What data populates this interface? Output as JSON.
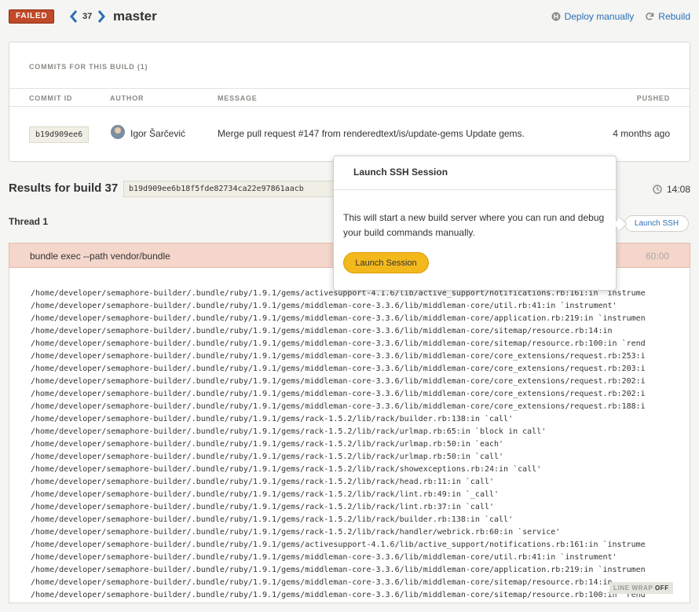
{
  "header": {
    "status": "FAILED",
    "build_number": "37",
    "branch": "master",
    "deploy_label": "Deploy manually",
    "rebuild_label": "Rebuild"
  },
  "commits": {
    "title": "COMMITS FOR THIS BUILD (1)",
    "columns": {
      "commit_id": "COMMIT ID",
      "author": "AUTHOR",
      "message": "MESSAGE",
      "pushed": "PUSHED"
    },
    "rows": [
      {
        "sha": "b19d909ee6",
        "author": "Igor Šarčević",
        "message": "Merge pull request #147 from renderedtext/is/update-gems Update gems.",
        "pushed": "4 months ago"
      }
    ]
  },
  "results": {
    "title": "Results for build 37",
    "sha": "b19d909ee6b18f5fde82734ca22e97861aacb",
    "duration": "14:08"
  },
  "thread": {
    "title": "Thread 1",
    "ssh_button": "Launch SSH"
  },
  "command": {
    "text": "bundle exec --path vendor/bundle",
    "time": "60:00"
  },
  "log_lines": [
    "/home/developer/semaphore-builder/.bundle/ruby/1.9.1/gems/activesupport-4.1.6/lib/active_support/notifications.rb:161:in `instrume",
    "/home/developer/semaphore-builder/.bundle/ruby/1.9.1/gems/middleman-core-3.3.6/lib/middleman-core/util.rb:41:in `instrument'",
    "/home/developer/semaphore-builder/.bundle/ruby/1.9.1/gems/middleman-core-3.3.6/lib/middleman-core/application.rb:219:in `instrumen",
    "/home/developer/semaphore-builder/.bundle/ruby/1.9.1/gems/middleman-core-3.3.6/lib/middleman-core/sitemap/resource.rb:14:in",
    "/home/developer/semaphore-builder/.bundle/ruby/1.9.1/gems/middleman-core-3.3.6/lib/middleman-core/sitemap/resource.rb:100:in `rend",
    "/home/developer/semaphore-builder/.bundle/ruby/1.9.1/gems/middleman-core-3.3.6/lib/middleman-core/core_extensions/request.rb:253:i",
    "/home/developer/semaphore-builder/.bundle/ruby/1.9.1/gems/middleman-core-3.3.6/lib/middleman-core/core_extensions/request.rb:203:i",
    "/home/developer/semaphore-builder/.bundle/ruby/1.9.1/gems/middleman-core-3.3.6/lib/middleman-core/core_extensions/request.rb:202:i",
    "/home/developer/semaphore-builder/.bundle/ruby/1.9.1/gems/middleman-core-3.3.6/lib/middleman-core/core_extensions/request.rb:202:i",
    "/home/developer/semaphore-builder/.bundle/ruby/1.9.1/gems/middleman-core-3.3.6/lib/middleman-core/core_extensions/request.rb:188:i",
    "/home/developer/semaphore-builder/.bundle/ruby/1.9.1/gems/rack-1.5.2/lib/rack/builder.rb:138:in `call'",
    "/home/developer/semaphore-builder/.bundle/ruby/1.9.1/gems/rack-1.5.2/lib/rack/urlmap.rb:65:in `block in call'",
    "/home/developer/semaphore-builder/.bundle/ruby/1.9.1/gems/rack-1.5.2/lib/rack/urlmap.rb:50:in `each'",
    "/home/developer/semaphore-builder/.bundle/ruby/1.9.1/gems/rack-1.5.2/lib/rack/urlmap.rb:50:in `call'",
    "/home/developer/semaphore-builder/.bundle/ruby/1.9.1/gems/rack-1.5.2/lib/rack/showexceptions.rb:24:in `call'",
    "/home/developer/semaphore-builder/.bundle/ruby/1.9.1/gems/rack-1.5.2/lib/rack/head.rb:11:in `call'",
    "/home/developer/semaphore-builder/.bundle/ruby/1.9.1/gems/rack-1.5.2/lib/rack/lint.rb:49:in `_call'",
    "/home/developer/semaphore-builder/.bundle/ruby/1.9.1/gems/rack-1.5.2/lib/rack/lint.rb:37:in `call'",
    "/home/developer/semaphore-builder/.bundle/ruby/1.9.1/gems/rack-1.5.2/lib/rack/builder.rb:138:in `call'",
    "/home/developer/semaphore-builder/.bundle/ruby/1.9.1/gems/rack-1.5.2/lib/rack/handler/webrick.rb:60:in `service'",
    "/home/developer/semaphore-builder/.bundle/ruby/1.9.1/gems/activesupport-4.1.6/lib/active_support/notifications.rb:161:in `instrume",
    "/home/developer/semaphore-builder/.bundle/ruby/1.9.1/gems/middleman-core-3.3.6/lib/middleman-core/util.rb:41:in `instrument'",
    "/home/developer/semaphore-builder/.bundle/ruby/1.9.1/gems/middleman-core-3.3.6/lib/middleman-core/application.rb:219:in `instrumen",
    "/home/developer/semaphore-builder/.bundle/ruby/1.9.1/gems/middleman-core-3.3.6/lib/middleman-core/sitemap/resource.rb:14:in",
    "/home/developer/semaphore-builder/.bundle/ruby/1.9.1/gems/middleman-core-3.3.6/lib/middleman-core/sitemap/resource.rb:100:in `rend"
  ],
  "line_wrap": {
    "label": "LINE WRAP",
    "state": "OFF"
  },
  "popover": {
    "title": "Launch SSH Session",
    "body": "This will start a new build server where you can run and debug your build commands manually.",
    "button": "Launch Session"
  },
  "colors": {
    "failed": "#c14a29",
    "link": "#2d6fb5",
    "command_bar": "#f4d6cb",
    "launch_button": "#f3b81b"
  },
  "icons": {
    "prev": "chevron-left-icon",
    "next": "chevron-right-icon",
    "deploy": "deploy-icon",
    "rebuild": "refresh-icon",
    "duration": "clock-icon"
  }
}
